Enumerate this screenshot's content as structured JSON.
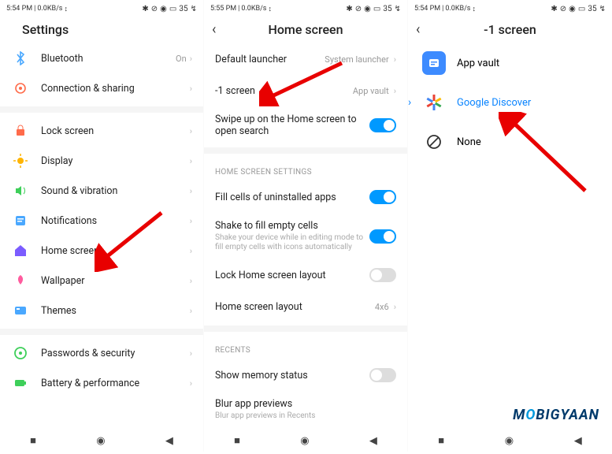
{
  "panel1": {
    "status": {
      "time": "5:54 PM",
      "net": "0.0KB/s",
      "batt": "35"
    },
    "title": "Settings",
    "items": [
      {
        "label": "Bluetooth",
        "value": "On"
      },
      {
        "label": "Connection & sharing"
      },
      {
        "label": "Lock screen"
      },
      {
        "label": "Display"
      },
      {
        "label": "Sound & vibration"
      },
      {
        "label": "Notifications"
      },
      {
        "label": "Home screen"
      },
      {
        "label": "Wallpaper"
      },
      {
        "label": "Themes"
      },
      {
        "label": "Passwords & security"
      },
      {
        "label": "Battery & performance"
      }
    ]
  },
  "panel2": {
    "status": {
      "time": "5:55 PM",
      "net": "0.0KB/s",
      "batt": "35"
    },
    "title": "Home screen",
    "items": [
      {
        "label": "Default launcher",
        "value": "System launcher"
      },
      {
        "label": "-1 screen",
        "value": "App vault"
      },
      {
        "label": "Swipe up on the Home screen to open search",
        "toggle": true
      }
    ],
    "section2_title": "HOME SCREEN SETTINGS",
    "section2": [
      {
        "label": "Fill cells of uninstalled apps",
        "toggle": true
      },
      {
        "label": "Shake to fill empty cells",
        "sub": "Shake your device while in editing mode to fill empty cells with icons automatically",
        "toggle": true
      },
      {
        "label": "Lock Home screen layout",
        "toggle": false
      },
      {
        "label": "Home screen layout",
        "value": "4x6"
      }
    ],
    "section3_title": "RECENTS",
    "section3": [
      {
        "label": "Show memory status",
        "toggle": false
      },
      {
        "label": "Blur app previews",
        "sub": "Blur app previews in Recents"
      }
    ]
  },
  "panel3": {
    "status": {
      "time": "5:54 PM",
      "net": "0.0KB/s",
      "batt": "35"
    },
    "title": "-1 screen",
    "items": [
      {
        "label": "App vault",
        "selected": false
      },
      {
        "label": "Google Discover",
        "selected": true
      },
      {
        "label": "None",
        "selected": false
      }
    ]
  },
  "watermark": {
    "pre": "M",
    "o": "O",
    "post": "BIGYAAN"
  }
}
